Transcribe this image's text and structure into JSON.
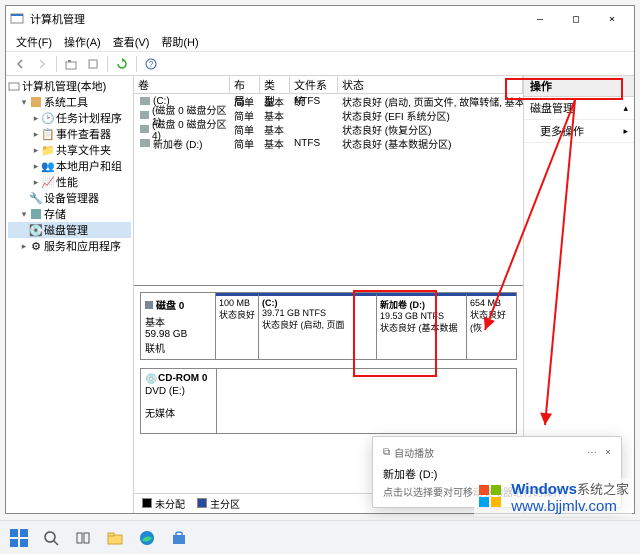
{
  "titlebar": {
    "title": "计算机管理"
  },
  "window_buttons": {
    "min": "—",
    "max": "□",
    "close": "×"
  },
  "menu": {
    "file": "文件(F)",
    "action": "操作(A)",
    "view": "查看(V)",
    "help": "帮助(H)"
  },
  "tree": {
    "root": "计算机管理(本地)",
    "sys_tools": "系统工具",
    "task_scheduler": "任务计划程序",
    "event_viewer": "事件查看器",
    "shared_folders": "共享文件夹",
    "local_users": "本地用户和组",
    "performance": "性能",
    "device_manager": "设备管理器",
    "storage": "存储",
    "disk_mgmt": "磁盘管理",
    "services_apps": "服务和应用程序"
  },
  "vol_head": {
    "vol": "卷",
    "layout": "布局",
    "type": "类型",
    "fs": "文件系统",
    "status": "状态"
  },
  "volumes": [
    {
      "name": "(C:)",
      "layout": "简单",
      "type": "基本",
      "fs": "NTFS",
      "status": "状态良好 (启动, 页面文件, 故障转储, 基本数据"
    },
    {
      "name": "(磁盘 0 磁盘分区 1)",
      "layout": "简单",
      "type": "基本",
      "fs": "",
      "status": "状态良好 (EFI 系统分区)"
    },
    {
      "name": "(磁盘 0 磁盘分区 4)",
      "layout": "简单",
      "type": "基本",
      "fs": "",
      "status": "状态良好 (恢复分区)"
    },
    {
      "name": "新加卷 (D:)",
      "layout": "简单",
      "type": "基本",
      "fs": "NTFS",
      "status": "状态良好 (基本数据分区)"
    }
  ],
  "disk0": {
    "header": "磁盘 0",
    "kind": "基本",
    "size": "59.98 GB",
    "state": "联机",
    "parts": [
      {
        "title": "",
        "size": "100 MB",
        "status": "状态良好"
      },
      {
        "title": "(C:)",
        "size": "39.71 GB NTFS",
        "status": "状态良好 (启动, 页面"
      },
      {
        "title": "新加卷  (D:)",
        "size": "19.53 GB NTFS",
        "status": "状态良好 (基本数据"
      },
      {
        "title": "",
        "size": "654 MB",
        "status": "状态良好 (恢"
      }
    ]
  },
  "cdrom": {
    "header": "CD-ROM 0",
    "line1": "DVD (E:)",
    "line2": "无媒体"
  },
  "legend": {
    "unalloc": "未分配",
    "primary": "主分区"
  },
  "actions": {
    "header": "操作",
    "disk_mgmt": "磁盘管理",
    "more": "更多操作"
  },
  "toast": {
    "app": "自动播放",
    "dots": "···",
    "close": "×",
    "title": "新加卷 (D:)",
    "body": "点击以选择要对可移动驱动器进行的操作。"
  },
  "watermark": {
    "brand": "Windows",
    "suffix": "系统之家",
    "url": "www.bjjmlv.com"
  }
}
